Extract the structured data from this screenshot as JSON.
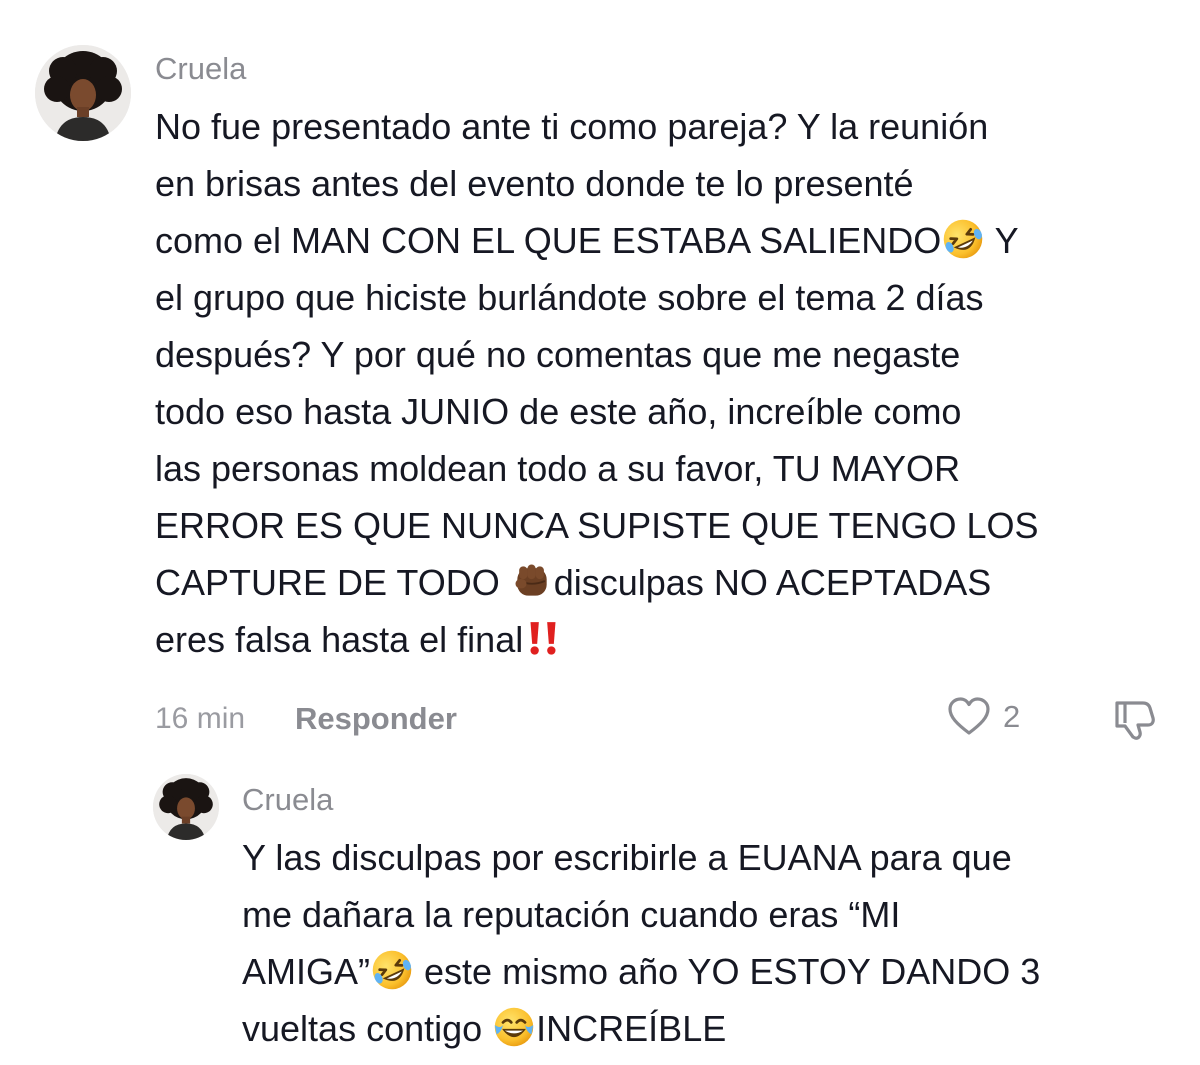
{
  "comments": [
    {
      "username": "Cruela",
      "lines": [
        "No fue presentado ante ti como pareja? Y la reunión",
        "en brisas antes del evento donde te lo presenté",
        "como el MAN CON EL QUE ESTABA SALIENDO",
        "el grupo que hiciste burlándote sobre el tema 2 días",
        "después? Y por qué no comentas que me negaste",
        "todo eso hasta JUNIO de este año, increíble como",
        "las personas moldean todo a su favor, TU MAYOR",
        "ERROR ES QUE NUNCA SUPISTE QUE TENGO LOS",
        "CAPTURE DE TODO",
        "eres falsa hasta el final"
      ],
      "line3_after_emoji": "Y",
      "line9_after_emoji": "disculpas NO ACEPTADAS",
      "emojis": {
        "line3": "rolling-on-floor-laughing",
        "line9": "oncoming-fist-dark-skin",
        "line10": "double-exclamation"
      },
      "time": "16 min",
      "reply_label": "Responder",
      "like_count": "2"
    },
    {
      "username": "Cruela",
      "lines": [
        "Y las disculpas por escribirle a EUANA para que",
        "me dañara la reputación cuando eras “MI",
        "AMIGA”",
        "vueltas contigo"
      ],
      "line3_after_emoji": "este mismo año YO ESTOY DANDO 3",
      "line4_after_emoji": "INCREÍBLE",
      "emojis": {
        "line3": "rolling-on-floor-laughing",
        "line4": "face-with-tears-of-joy"
      }
    }
  ],
  "colors": {
    "text": "#161823",
    "muted": "#8a8b91",
    "background": "#ffffff",
    "exclamation": "#e0201f"
  }
}
